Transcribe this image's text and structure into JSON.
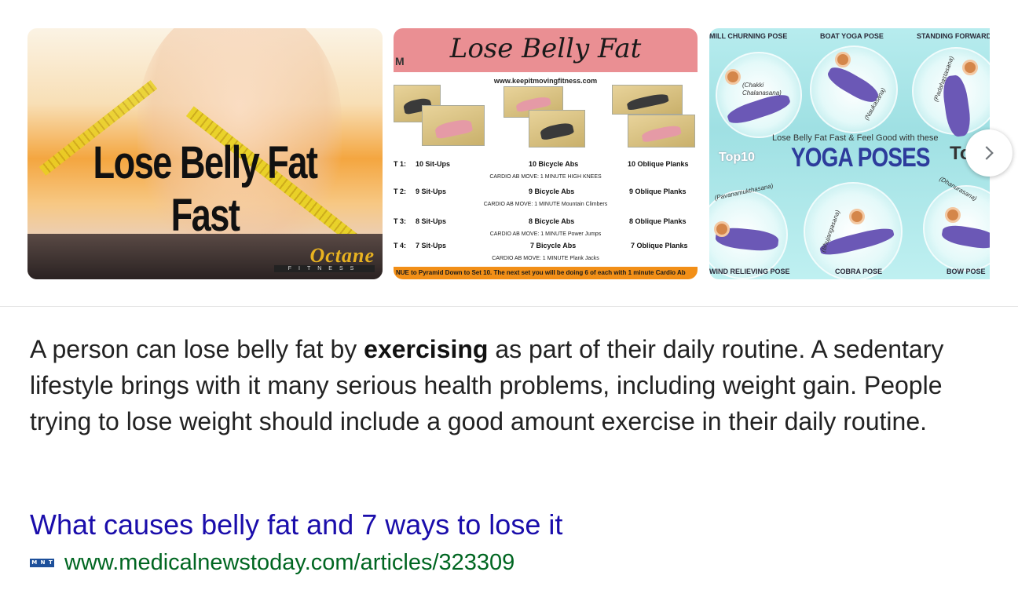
{
  "carousel": {
    "thumbnails": [
      {
        "title": "Lose Belly Fat Fast",
        "logo_word": "Octane",
        "logo_sub": "FITNESS"
      },
      {
        "title": "Lose Belly Fat",
        "logo_letter": "M",
        "url": "www.keepitmovingfitness.com",
        "sets": [
          {
            "label": "T 1:",
            "col1": "10 Sit-Ups",
            "col2": "10 Bicycle Abs",
            "col3": "10 Oblique Planks",
            "cardio": "CARDIO AB MOVE: 1 MINUTE  HIGH KNEES"
          },
          {
            "label": "T 2:",
            "col1": "9 Sit-Ups",
            "col2": "9 Bicycle Abs",
            "col3": "9 Oblique Planks",
            "cardio": "CARDIO AB MOVE: 1 MINUTE  Mountain Climbers"
          },
          {
            "label": "T 3:",
            "col1": "8 Sit-Ups",
            "col2": "8 Bicycle Abs",
            "col3": "8 Oblique Planks",
            "cardio": "CARDIO AB MOVE: 1 MINUTE  Power Jumps"
          },
          {
            "label": "T 4:",
            "col1": "7 Sit-Ups",
            "col2": "7 Bicycle Abs",
            "col3": "7 Oblique Planks",
            "cardio": "CARDIO AB MOVE: 1 MINUTE  Plank Jacks"
          }
        ],
        "footer": "NUE to Pyramid Down to Set 10. The next set you will be doing 6 of each with 1 minute Cardio Ab"
      },
      {
        "tagline": "Lose Belly Fat Fast & Feel Good with these",
        "headline": "YOGA POSES",
        "brand": "Top10",
        "brand_partial": "To",
        "pose_labels_top": [
          "MILL CHURNING POSE",
          "BOAT YOGA POSE",
          "STANDING FORWARD"
        ],
        "pose_labels_bottom": [
          "WIND RELIEVING POSE",
          "COBRA POSE",
          "BOW POSE"
        ],
        "sanskrit": [
          "(Chakki Chalanasana)",
          "(Naukasana)",
          "(Padahastasana)",
          "(Pavanamukthasana)",
          "(Bhujangasana)",
          "(Dhanurasana)"
        ]
      }
    ],
    "next_icon": "chevron-right-icon"
  },
  "snippet": {
    "before": "A person can lose belly fat by ",
    "bold": "exercising",
    "after": " as part of their daily routine. A sedentary lifestyle brings with it many serious health problems, including weight gain. People trying to lose weight should include a good amount exercise in their daily routine."
  },
  "result": {
    "title": "What causes belly fat and 7 ways to lose it",
    "url": "www.medicalnewstoday.com/articles/323309",
    "favicon_letters": [
      "M",
      "N",
      "T"
    ]
  },
  "colors": {
    "link": "#1a0dab",
    "url_green": "#006621",
    "text": "#222222"
  }
}
